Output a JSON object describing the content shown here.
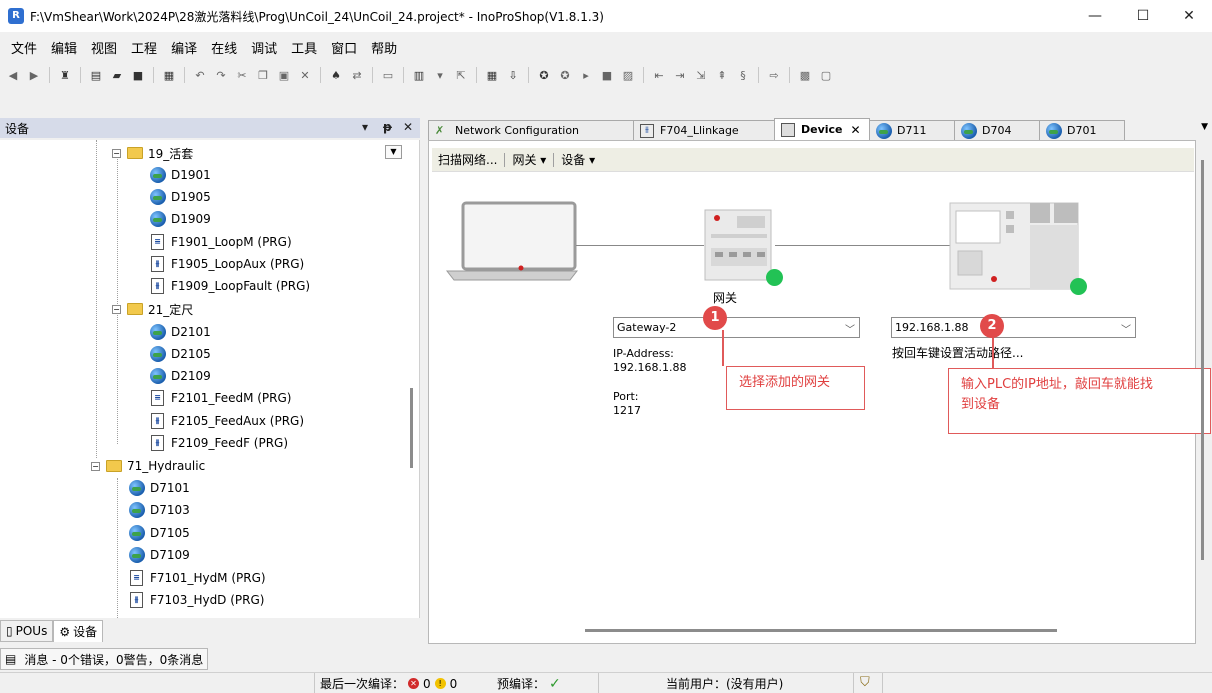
{
  "window": {
    "title": "F:\\VmShear\\Work\\2024P\\28激光落料线\\Prog\\UnCoil_24\\UnCoil_24.project* - InoProShop(V1.8.1.3)",
    "minimize": "—",
    "maximize": "☐",
    "close": "✕"
  },
  "menu": [
    "文件",
    "编辑",
    "视图",
    "工程",
    "编译",
    "在线",
    "调试",
    "工具",
    "窗口",
    "帮助"
  ],
  "devices_panel": {
    "title": "设备",
    "tree": [
      {
        "label": "19_活套",
        "type": "folder",
        "level": 0
      },
      {
        "label": "D1901",
        "type": "device",
        "level": 1
      },
      {
        "label": "D1905",
        "type": "device",
        "level": 1
      },
      {
        "label": "D1909",
        "type": "device",
        "level": 1
      },
      {
        "label": "F1901_LoopM (PRG)",
        "type": "prg",
        "level": 1
      },
      {
        "label": "F1905_LoopAux (PRG)",
        "type": "prg-ld",
        "level": 1
      },
      {
        "label": "F1909_LoopFault (PRG)",
        "type": "prg-ld",
        "level": 1
      },
      {
        "label": "21_定尺",
        "type": "folder",
        "level": 0
      },
      {
        "label": "D2101",
        "type": "device",
        "level": 1
      },
      {
        "label": "D2105",
        "type": "device",
        "level": 1
      },
      {
        "label": "D2109",
        "type": "device",
        "level": 1
      },
      {
        "label": "F2101_FeedM (PRG)",
        "type": "prg",
        "level": 1
      },
      {
        "label": "F2105_FeedAux (PRG)",
        "type": "prg-ld",
        "level": 1
      },
      {
        "label": "F2109_FeedF (PRG)",
        "type": "prg-ld",
        "level": 1
      },
      {
        "label": "71_Hydraulic",
        "type": "folder",
        "level": -1
      },
      {
        "label": "D7101",
        "type": "device",
        "level": 0
      },
      {
        "label": "D7103",
        "type": "device",
        "level": 0
      },
      {
        "label": "D7105",
        "type": "device",
        "level": 0
      },
      {
        "label": "D7109",
        "type": "device",
        "level": 0
      },
      {
        "label": "F7101_HydM (PRG)",
        "type": "prg",
        "level": 0
      },
      {
        "label": "F7103_HydD (PRG)",
        "type": "prg-ld",
        "level": 0
      }
    ],
    "bottom_tabs": [
      "POUs",
      "设备"
    ],
    "messages": "消息 - 0个错误，0警告，0条消息"
  },
  "doc_tabs": [
    {
      "label": "Network Configuration",
      "active": false
    },
    {
      "label": "F704_Llinkage",
      "active": false
    },
    {
      "label": "Device",
      "active": true
    },
    {
      "label": "D711",
      "active": false
    },
    {
      "label": "D704",
      "active": false
    },
    {
      "label": "D701",
      "active": false
    }
  ],
  "device_toolbar": {
    "scan": "扫描网络...",
    "gateway": "网关 ▾",
    "device": "设备 ▾"
  },
  "gateway": {
    "label": "网关",
    "combo_value": "Gateway-2",
    "ip_label": "IP-Address:",
    "ip_value": "192.168.1.88",
    "port_label": "Port:",
    "port_value": "1217"
  },
  "plc": {
    "combo_value": "192.168.1.88",
    "hint": "按回车键设置活动路径..."
  },
  "callouts": {
    "c1_number": "1",
    "c1_text": "选择添加的网关",
    "c2_number": "2",
    "c2_line1": "输入PLC的IP地址，敲回车就能找",
    "c2_line2": "到设备"
  },
  "status": {
    "last_compile_label": "最后一次编译：",
    "errors": "0",
    "warnings": "0",
    "precompile_label": "预编译：",
    "current_user": "当前用户：(没有用户)"
  }
}
